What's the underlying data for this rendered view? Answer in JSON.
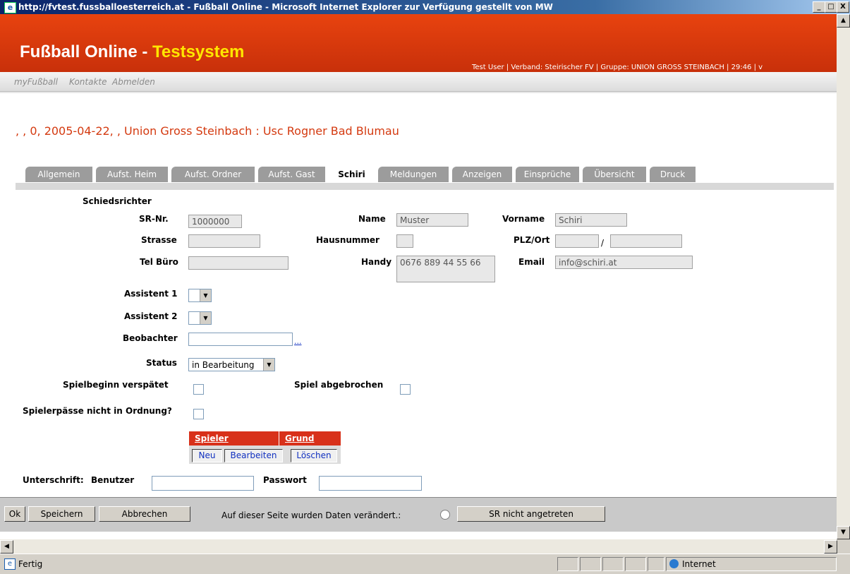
{
  "window": {
    "title": "http://fvtest.fussballoesterreich.at - Fußball Online - Microsoft Internet Explorer  zur Verfügung gestellt von MW",
    "min": "_",
    "max": "□",
    "close": "X"
  },
  "header": {
    "logo_main": "Fußball Online - ",
    "logo_accent": "Testsystem",
    "user_info": "Test User | Verband: Steirischer FV | Gruppe: UNION GROSS STEINBACH | 29:46 | v"
  },
  "nav": [
    "myFußball",
    "Kontakte",
    "Abmelden"
  ],
  "page_title": ", , 0, 2005-04-22, , Union Gross Steinbach : Usc Rogner Bad Blumau",
  "tabs": [
    {
      "label": "Allgemein"
    },
    {
      "label": "Aufst. Heim"
    },
    {
      "label": "Aufst. Ordner"
    },
    {
      "label": "Aufst. Gast"
    },
    {
      "label": "Schiri",
      "active": true
    },
    {
      "label": "Meldungen"
    },
    {
      "label": "Anzeigen"
    },
    {
      "label": "Einsprüche"
    },
    {
      "label": "Übersicht"
    },
    {
      "label": "Druck"
    }
  ],
  "form": {
    "section_label": "Schiedsrichter",
    "sr_nr_label": "SR-Nr.",
    "sr_nr_value": "1000000",
    "name_label": "Name",
    "name_value": "Muster",
    "vorname_label": "Vorname",
    "vorname_value": "Schiri",
    "strasse_label": "Strasse",
    "strasse_value": "",
    "hausnummer_label": "Hausnummer",
    "hausnummer_value": "",
    "plz_label": "PLZ/Ort",
    "plz_value": "",
    "ort_value": "",
    "plz_sep": "/",
    "tel_label": "Tel Büro",
    "tel_value": "",
    "handy_label": "Handy",
    "handy_value": "0676 889 44 55 66",
    "email_label": "Email",
    "email_value": "info@schiri.at",
    "assistent1_label": "Assistent 1",
    "assistent2_label": "Assistent 2",
    "beobachter_label": "Beobachter",
    "beobachter_value": "",
    "beobachter_link": "...",
    "status_label": "Status",
    "status_value": "in Bearbeitung",
    "spielbeginn_label": "Spielbeginn verspätet",
    "abgebrochen_label": "Spiel abgebrochen",
    "spielerpaesse_label": "Spielerpässe nicht in Ordnung?",
    "table_headers": [
      "Spieler",
      "Grund"
    ],
    "table_buttons": [
      "Neu",
      "Bearbeiten",
      "Löschen"
    ],
    "unterschrift_label": "Unterschrift:",
    "benutzer_label": "Benutzer",
    "passwort_label": "Passwort"
  },
  "bottom": {
    "ok": "Ok",
    "speichern": "Speichern",
    "abbrechen": "Abbrechen",
    "changed_text": "Auf dieser Seite wurden Daten verändert.:",
    "sr_nicht": "SR nicht angetreten"
  },
  "statusbar": {
    "text": "Fertig",
    "zone": "Internet"
  }
}
